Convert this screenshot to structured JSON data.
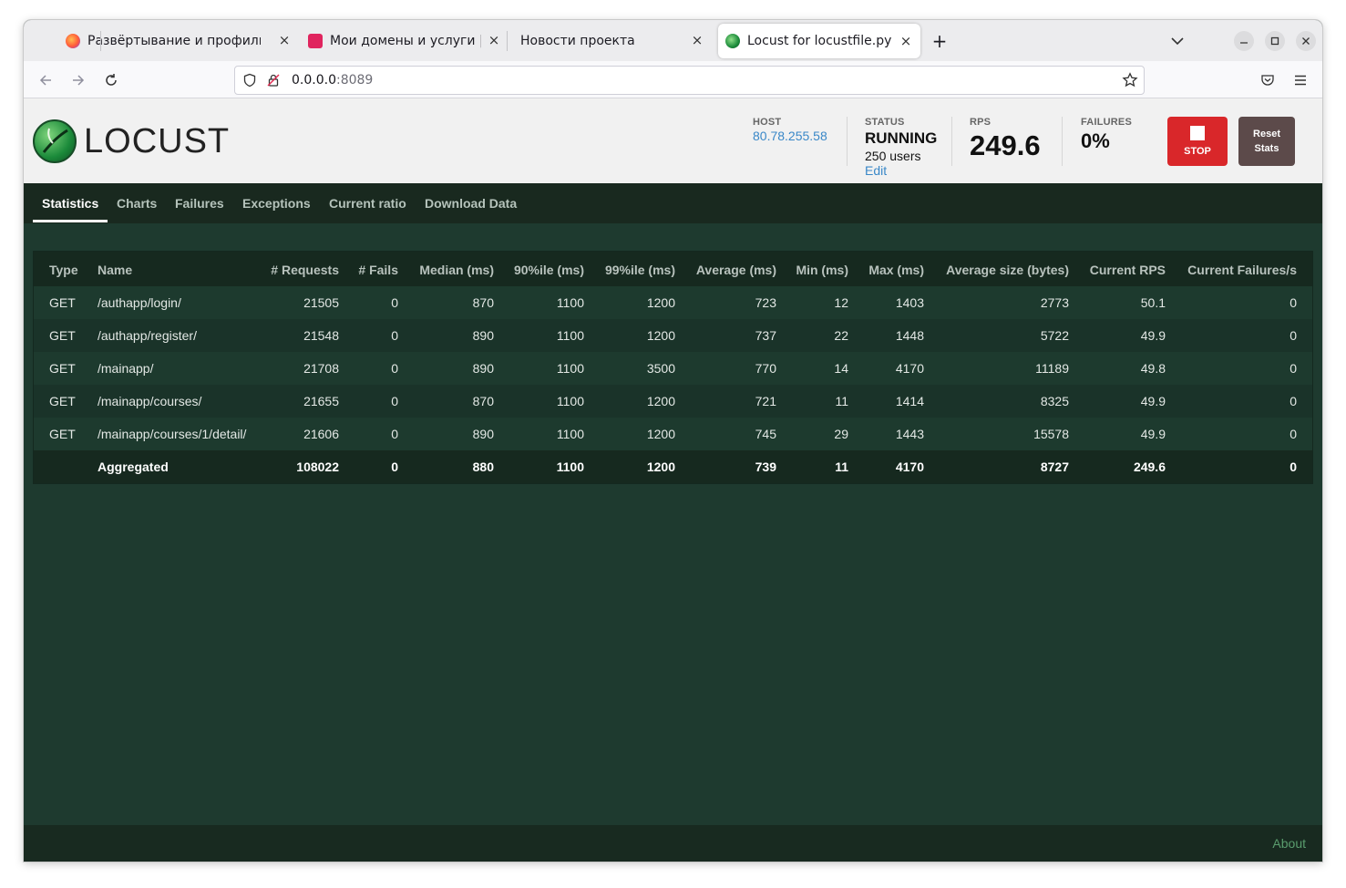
{
  "browser": {
    "tabs": [
      {
        "title": "Развёртывание и профили",
        "icon": "firefox-icon"
      },
      {
        "title": "Мои домены и услуги | R",
        "icon": "domain-icon"
      },
      {
        "title": "Новости проекта",
        "icon": ""
      },
      {
        "title": "Locust for locustfile.py",
        "icon": "locust-icon",
        "active": true
      }
    ],
    "url_host": "0.0.0.0",
    "url_port": ":8089",
    "new_tab": "+",
    "close_glyph": "×"
  },
  "header": {
    "logo_text": "LOCUST",
    "host_label": "HOST",
    "host_value": "80.78.255.58",
    "status_label": "STATUS",
    "status_value": "RUNNING",
    "users_text": "250 users",
    "edit_label": "Edit",
    "rps_label": "RPS",
    "rps_value": "249.6",
    "failures_label": "FAILURES",
    "failures_value": "0%",
    "stop_label": "STOP",
    "reset_label_1": "Reset",
    "reset_label_2": "Stats"
  },
  "menu": {
    "items": [
      "Statistics",
      "Charts",
      "Failures",
      "Exceptions",
      "Current ratio",
      "Download Data"
    ],
    "active": "Statistics"
  },
  "table": {
    "columns": [
      "Type",
      "Name",
      "# Requests",
      "# Fails",
      "Median (ms)",
      "90%ile (ms)",
      "99%ile (ms)",
      "Average (ms)",
      "Min (ms)",
      "Max (ms)",
      "Average size (bytes)",
      "Current RPS",
      "Current Failures/s"
    ],
    "rows": [
      [
        "GET",
        "/authapp/login/",
        "21505",
        "0",
        "870",
        "1100",
        "1200",
        "723",
        "12",
        "1403",
        "2773",
        "50.1",
        "0"
      ],
      [
        "GET",
        "/authapp/register/",
        "21548",
        "0",
        "890",
        "1100",
        "1200",
        "737",
        "22",
        "1448",
        "5722",
        "49.9",
        "0"
      ],
      [
        "GET",
        "/mainapp/",
        "21708",
        "0",
        "890",
        "1100",
        "3500",
        "770",
        "14",
        "4170",
        "11189",
        "49.8",
        "0"
      ],
      [
        "GET",
        "/mainapp/courses/",
        "21655",
        "0",
        "870",
        "1100",
        "1200",
        "721",
        "11",
        "1414",
        "8325",
        "49.9",
        "0"
      ],
      [
        "GET",
        "/mainapp/courses/1/detail/",
        "21606",
        "0",
        "890",
        "1100",
        "1200",
        "745",
        "29",
        "1443",
        "15578",
        "49.9",
        "0"
      ]
    ],
    "aggregated": [
      "",
      "Aggregated",
      "108022",
      "0",
      "880",
      "1100",
      "1200",
      "739",
      "11",
      "4170",
      "8727",
      "249.6",
      "0"
    ]
  },
  "footer": {
    "about_label": "About"
  },
  "colors": {
    "stop": "#d9272a",
    "reset": "#5c4a4a",
    "background": "#1e3a2f",
    "host_link": "#3a88c8"
  }
}
